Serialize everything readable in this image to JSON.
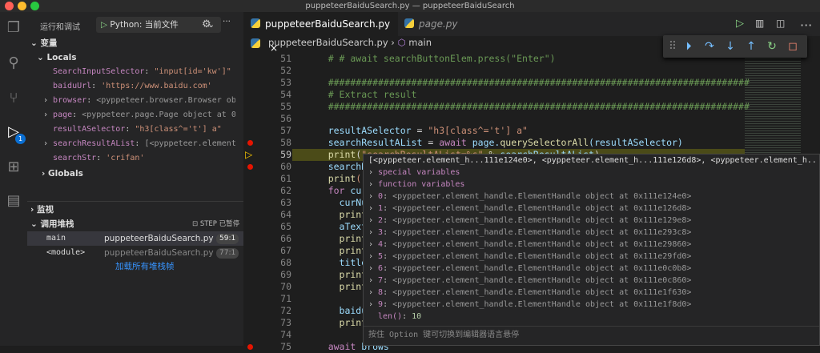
{
  "window": {
    "title": "puppeteerBaiduSearch.py — puppeteerBaiduSearch"
  },
  "sidebar": {
    "title": "运行和调试",
    "config": "Python: 当前文件",
    "variables_label": "变量",
    "locals_label": "Locals",
    "globals_label": "Globals",
    "locals": [
      {
        "name": "SearchInputSelector",
        "value": "\"input[id='kw']\"",
        "expandable": false,
        "type": "str"
      },
      {
        "name": "baiduUrl",
        "value": "'https://www.baidu.com'",
        "expandable": false,
        "type": "str"
      },
      {
        "name": "browser",
        "value": "<pyppeteer.browser.Browser object…",
        "expandable": true,
        "type": "obj"
      },
      {
        "name": "page",
        "value": "<pyppeteer.page.Page object at 0x111…",
        "expandable": true,
        "type": "obj"
      },
      {
        "name": "resultASelector",
        "value": "\"h3[class^='t'] a\"",
        "expandable": false,
        "type": "str"
      },
      {
        "name": "searchResultAList",
        "value": "[<pyppeteer.element_h...…",
        "expandable": true,
        "type": "obj"
      },
      {
        "name": "searchStr",
        "value": "'crifan'",
        "expandable": false,
        "type": "str"
      }
    ],
    "watch_label": "监视",
    "callstack_label": "调用堆栈",
    "callstack_status": "STEP 已暂停",
    "frames": [
      {
        "name": "main",
        "file": "puppeteerBaiduSearch.py",
        "pos": "59:1"
      },
      {
        "name": "<module>",
        "file": "puppeteerBaiduSearch.py",
        "pos": "77:1"
      }
    ],
    "load_all": "加载所有堆栈帧",
    "debug_badge": "1"
  },
  "editor": {
    "tabs": [
      {
        "label": "puppeteerBaiduSearch.py",
        "active": true
      },
      {
        "label": "page.py",
        "active": false
      }
    ],
    "breadcrumb": {
      "file": "puppeteerBaiduSearch.py",
      "symbol": "main"
    },
    "current_line": 59,
    "breakpoints": [
      58,
      60,
      75
    ],
    "lines": [
      {
        "n": "51",
        "t": [
          [
            "    # # await searchButtonElem.press(\"Enter\")",
            "c"
          ]
        ]
      },
      {
        "n": "52",
        "t": []
      },
      {
        "n": "53",
        "t": [
          [
            "    ############################################################################",
            "c"
          ]
        ]
      },
      {
        "n": "54",
        "t": [
          [
            "    # Extract result",
            "c"
          ]
        ]
      },
      {
        "n": "55",
        "t": [
          [
            "    ############################################################################",
            "c"
          ]
        ]
      },
      {
        "n": "56",
        "t": []
      },
      {
        "n": "57",
        "t": [
          [
            "    resultASelector",
            "v"
          ],
          [
            " = ",
            "d"
          ],
          [
            "\"h3[class^='t'] a\"",
            "s"
          ]
        ]
      },
      {
        "n": "58",
        "t": [
          [
            "    searchResultAList",
            "v"
          ],
          [
            " = ",
            "d"
          ],
          [
            "await",
            "k"
          ],
          [
            " page.",
            "v"
          ],
          [
            "querySelectorAll",
            "f"
          ],
          [
            "(resultASelector)",
            "v"
          ]
        ]
      },
      {
        "n": "59",
        "t": [
          [
            "    print",
            "f"
          ],
          [
            "(",
            "d"
          ],
          [
            "\"searchResultAList=%s\"",
            "s"
          ],
          [
            " % ",
            "d"
          ],
          [
            "searchResultAList",
            "v"
          ],
          [
            ")",
            "d"
          ]
        ]
      },
      {
        "n": "60",
        "t": [
          [
            "    searchResul",
            "v"
          ]
        ]
      },
      {
        "n": "61",
        "t": [
          [
            "    print",
            "f"
          ],
          [
            "(\"sear",
            "s"
          ]
        ]
      },
      {
        "n": "62",
        "t": [
          [
            "    for",
            "k"
          ],
          [
            " curIdx,",
            "v"
          ]
        ]
      },
      {
        "n": "63",
        "t": [
          [
            "      curNum",
            "v"
          ],
          [
            " =",
            "d"
          ]
        ]
      },
      {
        "n": "64",
        "t": [
          [
            "      print",
            "f"
          ],
          [
            "(\"%s",
            "s"
          ]
        ]
      },
      {
        "n": "65",
        "t": [
          [
            "      aTextJSHa",
            "v"
          ]
        ]
      },
      {
        "n": "66",
        "t": [
          [
            "      print",
            "f"
          ],
          [
            "(\"ty",
            "s"
          ]
        ]
      },
      {
        "n": "67",
        "t": [
          [
            "      print",
            "f"
          ],
          [
            "(\"aT",
            "s"
          ]
        ]
      },
      {
        "n": "68",
        "t": [
          [
            "      title",
            "v"
          ],
          [
            " = a",
            "d"
          ]
        ]
      },
      {
        "n": "69",
        "t": [
          [
            "      print",
            "f"
          ],
          [
            "(\"ty",
            "s"
          ]
        ]
      },
      {
        "n": "70",
        "t": [
          [
            "      print",
            "f"
          ],
          [
            "(\"ti",
            "s"
          ]
        ]
      },
      {
        "n": "71",
        "t": []
      },
      {
        "n": "72",
        "t": [
          [
            "      baiduLink",
            "v"
          ]
        ]
      },
      {
        "n": "73",
        "t": [
          [
            "      print",
            "f"
          ],
          [
            "(\"ba",
            "s"
          ]
        ]
      },
      {
        "n": "74",
        "t": []
      },
      {
        "n": "75",
        "t": [
          [
            "    await",
            "k"
          ],
          [
            " brows",
            "v"
          ]
        ]
      }
    ]
  },
  "hover": {
    "summary": "[<pyppeteer.element_h...111e124e0>, <pyppeteer.element_h...111e126d8>, <pyppeteer.element_h...111e129e…",
    "groups": [
      "special variables",
      "function variables"
    ],
    "items": [
      {
        "k": "0",
        "v": "<pyppeteer.element_handle.ElementHandle object at 0x111e124e0>"
      },
      {
        "k": "1",
        "v": "<pyppeteer.element_handle.ElementHandle object at 0x111e126d8>"
      },
      {
        "k": "2",
        "v": "<pyppeteer.element_handle.ElementHandle object at 0x111e129e8>"
      },
      {
        "k": "3",
        "v": "<pyppeteer.element_handle.ElementHandle object at 0x111e293c8>"
      },
      {
        "k": "4",
        "v": "<pyppeteer.element_handle.ElementHandle object at 0x111e29860>"
      },
      {
        "k": "5",
        "v": "<pyppeteer.element_handle.ElementHandle object at 0x111e29fd0>"
      },
      {
        "k": "6",
        "v": "<pyppeteer.element_handle.ElementHandle object at 0x111e0c0b8>"
      },
      {
        "k": "7",
        "v": "<pyppeteer.element_handle.ElementHandle object at 0x111e0c860>"
      },
      {
        "k": "8",
        "v": "<pyppeteer.element_handle.ElementHandle object at 0x111e1f630>"
      },
      {
        "k": "9",
        "v": "<pyppeteer.element_handle.ElementHandle object at 0x111e1f8d0>"
      }
    ],
    "len_label": "len()",
    "len_value": "10",
    "hint": "按住 Option 键可切换到编辑器语言悬停"
  }
}
